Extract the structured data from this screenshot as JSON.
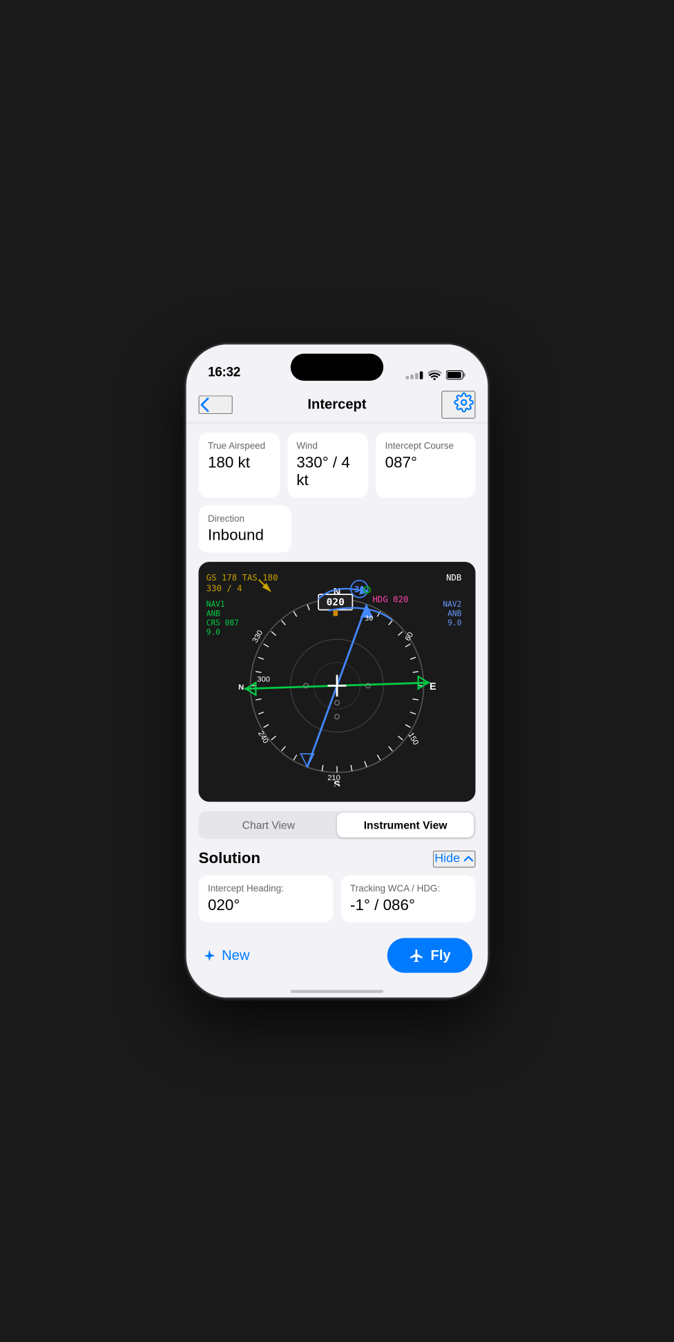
{
  "status": {
    "time": "16:32",
    "wifi": true,
    "battery": true
  },
  "nav": {
    "back_label": "‹",
    "title": "Intercept",
    "gear_label": "⚙"
  },
  "inputs": {
    "true_airspeed": {
      "label": "True Airspeed",
      "value": "180 kt"
    },
    "wind": {
      "label": "Wind",
      "value": "330° / 4 kt"
    },
    "intercept_course": {
      "label": "Intercept Course",
      "value": "087°"
    },
    "direction": {
      "label": "Direction",
      "value": "Inbound"
    }
  },
  "hsi": {
    "gs": "GS 178  TAS 180",
    "wind": "330 / 4",
    "nav1_label": "NAV1",
    "nav1_id": "ANB",
    "nav1_crs": "CRS 087",
    "nav1_dist": "9.0",
    "nav2_label": "NAV2",
    "nav2_id": "ANB",
    "nav2_dist": "9.0",
    "ndb_label": "NDB",
    "heading_box": "020",
    "hdg_label": "HDG 020"
  },
  "view_toggle": {
    "chart_view": "Chart View",
    "instrument_view": "Instrument View",
    "active": "instrument"
  },
  "solution": {
    "title": "Solution",
    "hide_label": "Hide",
    "intercept_heading_label": "Intercept Heading:",
    "intercept_heading_value": "020°",
    "tracking_wca_label": "Tracking WCA / HDG:",
    "tracking_wca_value": "-1° / 086°"
  },
  "actions": {
    "new_label": "New",
    "fly_label": "Fly"
  }
}
